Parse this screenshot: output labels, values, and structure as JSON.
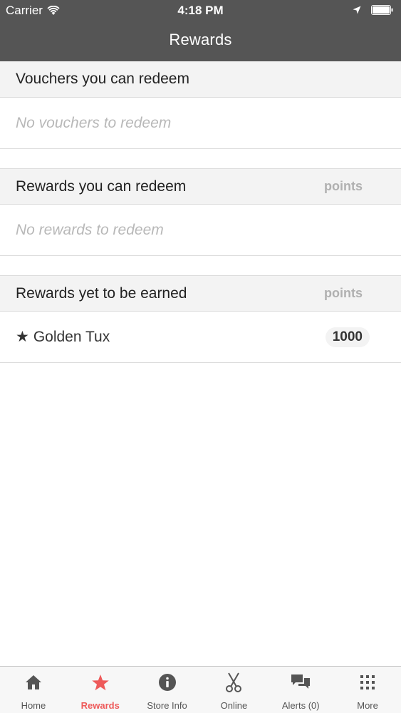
{
  "status_bar": {
    "carrier": "Carrier",
    "time": "4:18 PM"
  },
  "nav": {
    "title": "Rewards"
  },
  "sections": {
    "vouchers": {
      "title": "Vouchers you can redeem",
      "empty": "No vouchers to redeem"
    },
    "redeemable": {
      "title": "Rewards you can redeem",
      "column": "points",
      "empty": "No rewards to redeem"
    },
    "to_earn": {
      "title": "Rewards yet to be earned",
      "column": "points",
      "items": [
        {
          "icon": "star-icon",
          "name": "Golden Tux",
          "points": "1000"
        }
      ]
    }
  },
  "tabbar": {
    "items": [
      {
        "label": "Home",
        "icon": "home-icon"
      },
      {
        "label": "Rewards",
        "icon": "star-icon",
        "active": true
      },
      {
        "label": "Store Info",
        "icon": "info-icon"
      },
      {
        "label": "Online",
        "icon": "scissors-icon"
      },
      {
        "label": "Alerts (0)",
        "icon": "chat-icon"
      },
      {
        "label": "More",
        "icon": "grid-icon"
      }
    ]
  },
  "colors": {
    "header_bg": "#555555",
    "accent": "#ee5a5a",
    "section_bg": "#f3f3f3",
    "tabbar_bg": "#f7f7f7"
  }
}
